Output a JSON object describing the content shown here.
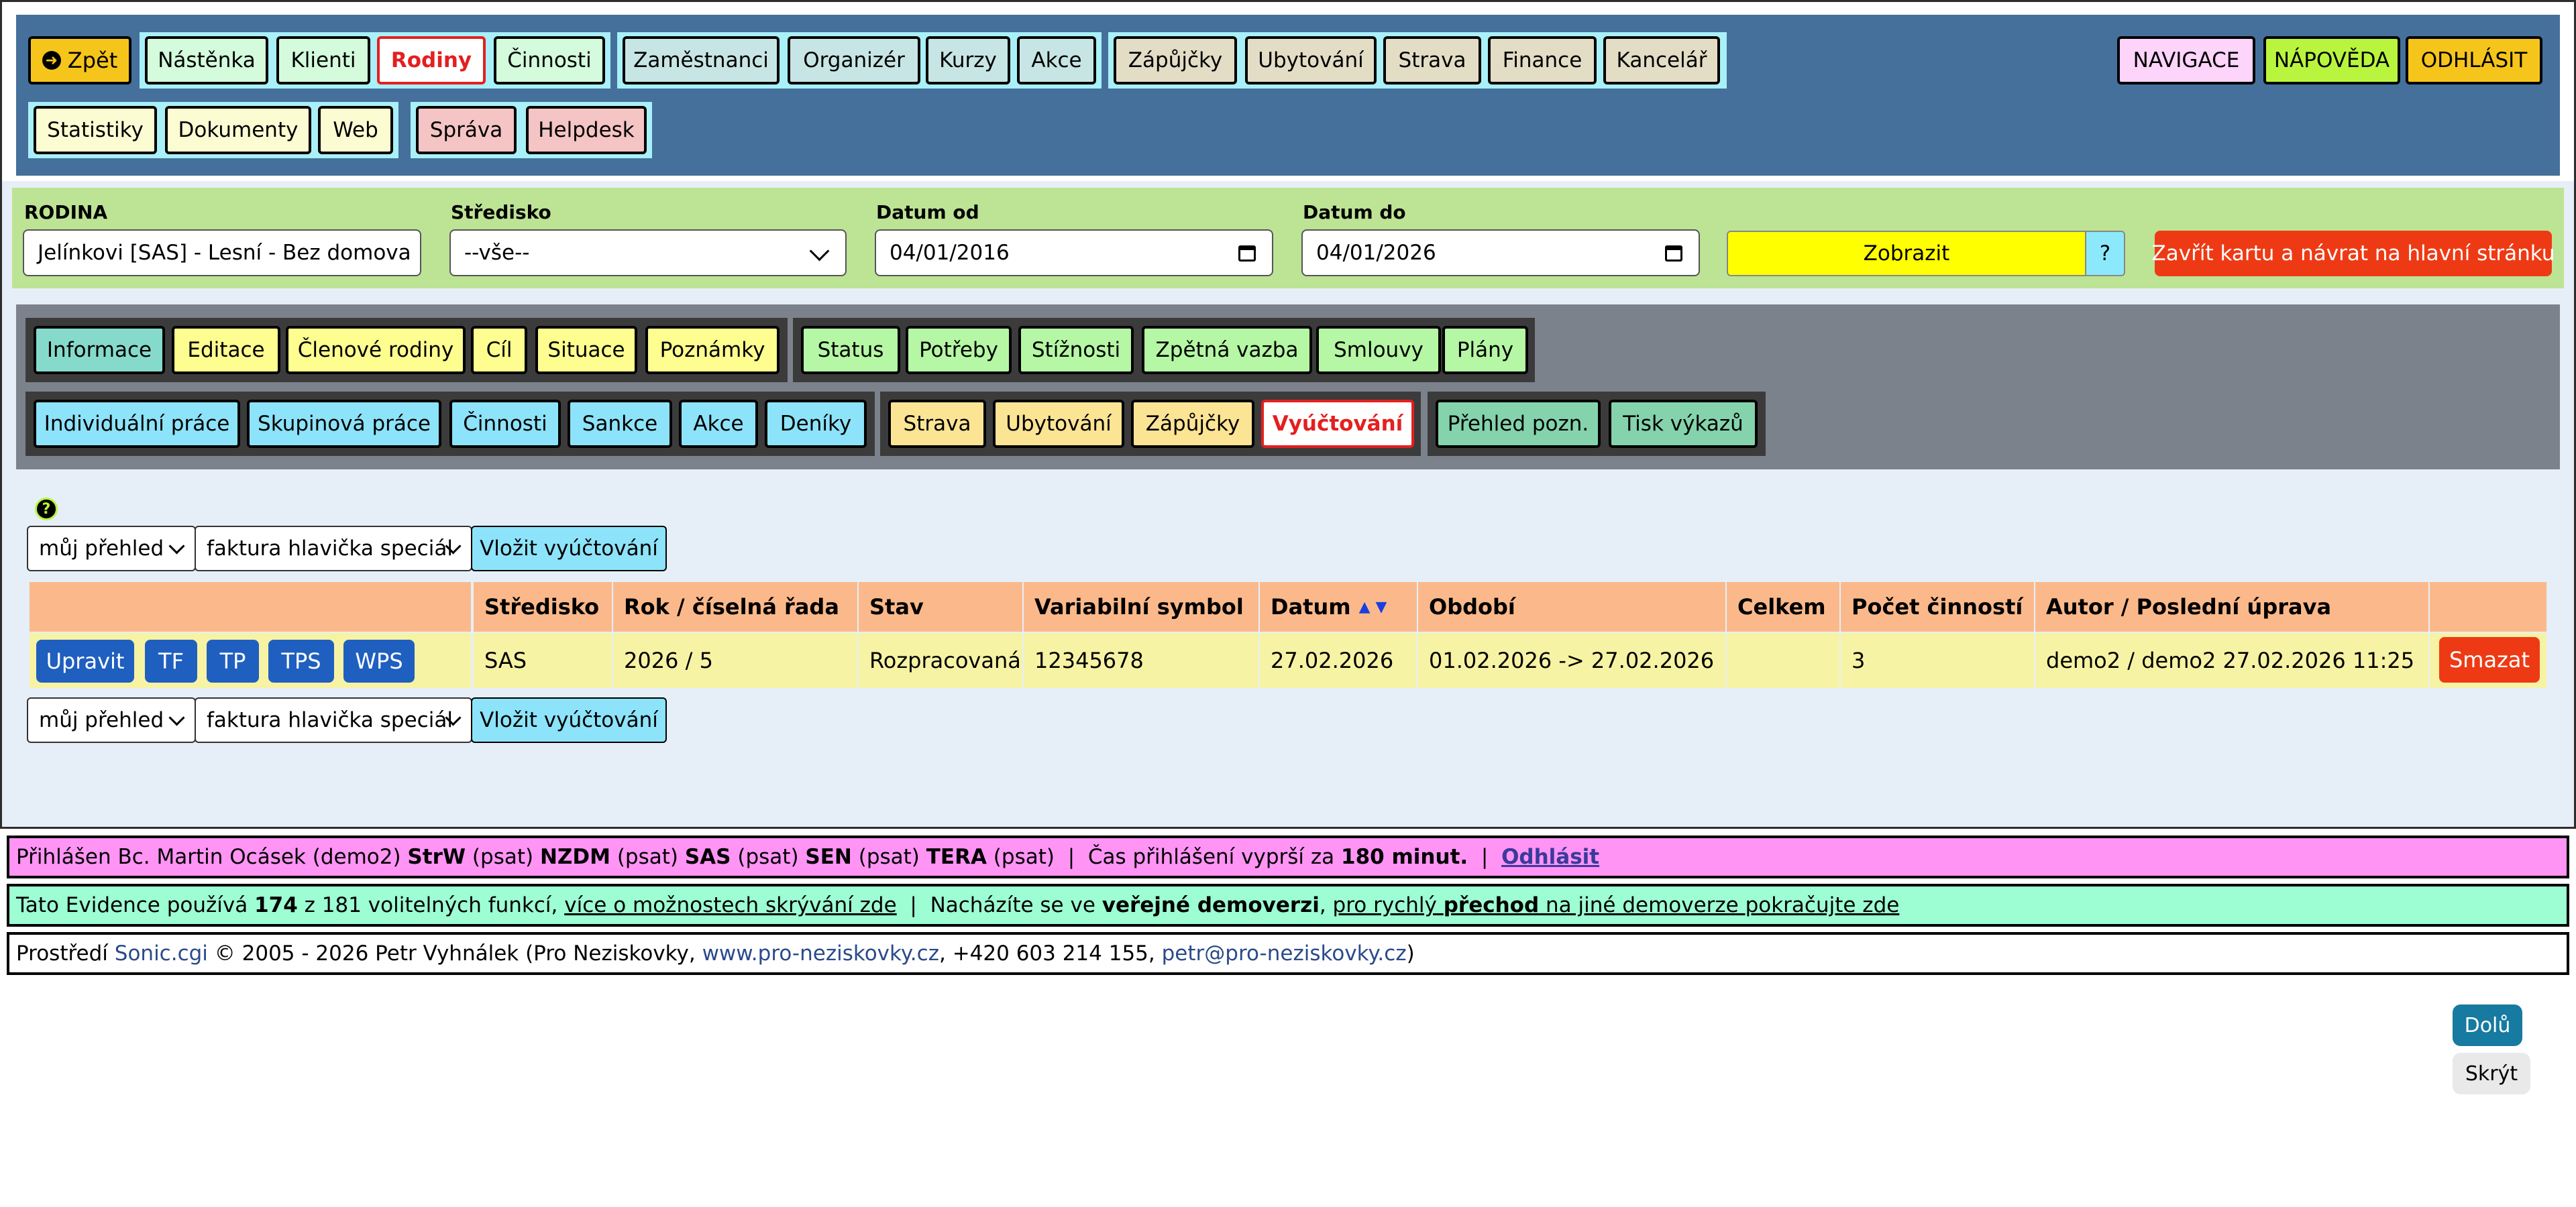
{
  "colors": {
    "top_band": "#45709b",
    "filter_band": "#bde394",
    "tab_band": "#7c828c",
    "content_bg": "#e6eff8",
    "footer_login": "#ff94f5",
    "footer_info": "#9dfdd3"
  },
  "nav": {
    "back": {
      "label": "Zpět",
      "icon": "circle-arrow-left-icon"
    },
    "group1": [
      "Nástěnka",
      "Klienti",
      "Rodiny",
      "Činnosti"
    ],
    "group2": [
      "Zaměstnanci",
      "Organizér",
      "Kurzy",
      "Akce"
    ],
    "group3": [
      "Zápůjčky",
      "Ubytování",
      "Strava",
      "Finance",
      "Kancelář"
    ],
    "group4": [
      "Statistiky",
      "Dokumenty",
      "Web"
    ],
    "group5": [
      "Správa",
      "Helpdesk"
    ],
    "right": [
      "NAVIGACE",
      "NÁPOVĚDA",
      "ODHLÁSIT"
    ],
    "active": "Rodiny"
  },
  "filter": {
    "rodina_label": "RODINA",
    "rodina_value": "Jelínkovi [SAS] - Lesní - Bez domova",
    "stredisko_label": "Středisko",
    "stredisko_value": "--vše--",
    "datum_od_label": "Datum od",
    "datum_od_value": "04/01/2016",
    "datum_do_label": "Datum do",
    "datum_do_value": "04/01/2026",
    "show_button": "Zobrazit",
    "help_button": "?",
    "close_button": "Zavřít kartu a návrat na hlavní stránku"
  },
  "tabs": {
    "row1_group1": [
      "Informace",
      "Editace",
      "Členové rodiny",
      "Cíl",
      "Situace",
      "Poznámky"
    ],
    "row1_group2": [
      "Status",
      "Potřeby",
      "Stížnosti",
      "Zpětná vazba",
      "Smlouvy",
      "Plány"
    ],
    "row2_group1": [
      "Individuální práce",
      "Skupinová práce",
      "Činnosti",
      "Sankce",
      "Akce",
      "Deníky"
    ],
    "row2_group2": [
      "Strava",
      "Ubytování",
      "Zápůjčky",
      "Vyúčtování"
    ],
    "row2_group3": [
      "Přehled pozn.",
      "Tisk výkazů"
    ],
    "active": "Vyúčtování"
  },
  "content": {
    "help_icon": "question-circle-icon",
    "view_select": "můj přehled",
    "template_select": "faktura hlavička speciál",
    "insert_button": "Vložit vyúčtování",
    "table": {
      "headers": [
        "",
        "Středisko",
        "Rok / číselná řada",
        "Stav",
        "Variabilní symbol",
        "Datum",
        "Období",
        "Celkem",
        "Počet činností",
        "Autor / Poslední úprava",
        ""
      ],
      "sort_icons": [
        "sort-asc-icon",
        "sort-desc-icon"
      ],
      "row": {
        "actions": [
          "Upravit",
          "TF",
          "TP",
          "TPS",
          "WPS"
        ],
        "stredisko": "SAS",
        "rok": "2026 / 5",
        "stav": "Rozpracovaná",
        "vs": "12345678",
        "datum": "27.02.2026",
        "obdobi": "01.02.2026 -> 27.02.2026",
        "celkem": "",
        "pocet": "3",
        "autor": "demo2 / demo2 27.02.2026 11:25",
        "delete": "Smazat"
      }
    }
  },
  "footer": {
    "login_prefix": "Přihlášen Bc. Martin Ocásek (demo2)",
    "orgs": [
      {
        "code": "StrW",
        "note": "(psat)"
      },
      {
        "code": "NZDM",
        "note": "(psat)"
      },
      {
        "code": "SAS",
        "note": "(psat)"
      },
      {
        "code": "SEN",
        "note": "(psat)"
      },
      {
        "code": "TERA",
        "note": "(psat)"
      }
    ],
    "separator": "|",
    "expiry_text": "Čas přihlášení vyprší za",
    "expiry_value": "180 minut.",
    "logout_link": "Odhlásit",
    "info_prefix": "Tato Evidence používá",
    "info_count": "174",
    "info_mid": "z 181 volitelných funkcí,",
    "info_link": "více o možnostech skrývání zde",
    "info_demo_pre": "Nacházíte se ve",
    "info_demo_bold": "veřejné demoverzi",
    "info_link2_pre": "pro rychlý",
    "info_link2_bold": "přechod",
    "info_link2_post": "na jiné demoverze pokračujte zde",
    "credit_prefix": "Prostředí",
    "credit_product": "Sonic.cgi",
    "credit_mid": "© 2005 - 2026 Petr Vyhnálek (Pro Neziskovky,",
    "credit_web": "www.pro-neziskovky.cz",
    "credit_phone": ", +420 603 214 155,",
    "credit_email": "petr@pro-neziskovky.cz",
    "credit_end": ")"
  },
  "float": {
    "down_button": "Dolů",
    "hide_button": "Skrýt"
  }
}
